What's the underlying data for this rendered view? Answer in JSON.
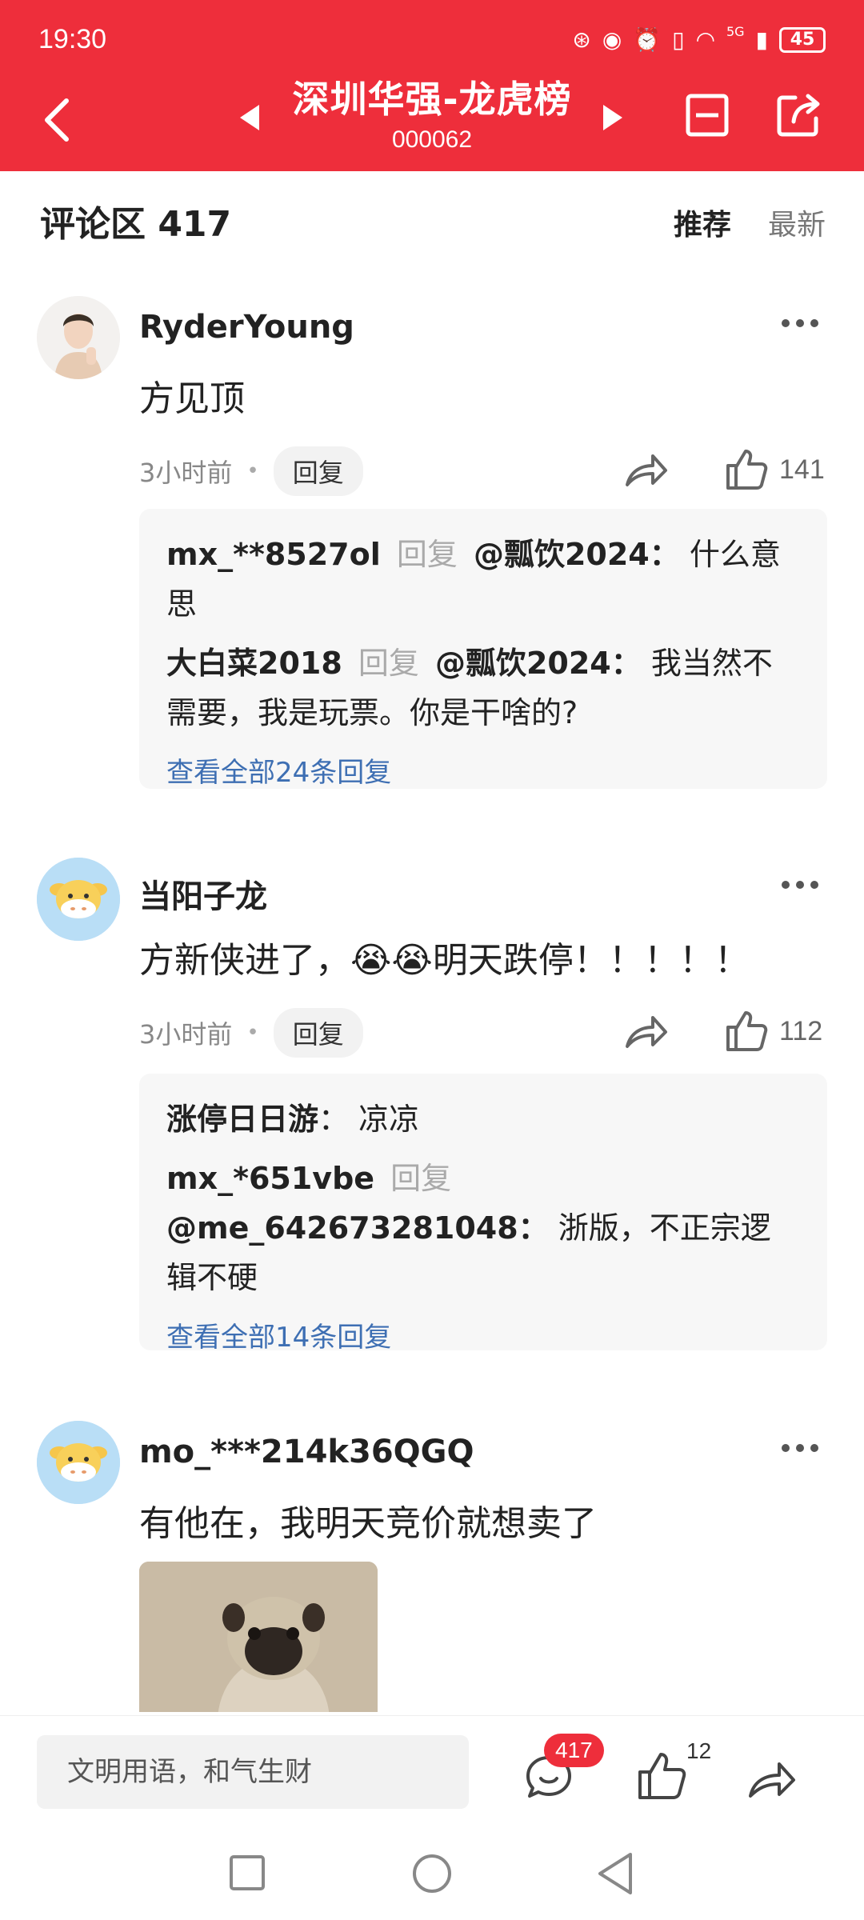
{
  "status_bar": {
    "time": "19:30",
    "network": "5G",
    "battery": "45"
  },
  "header": {
    "title": "深圳华强-龙虎榜",
    "code": "000062"
  },
  "comments_header": {
    "title": "评论区 417",
    "tabs": [
      "推荐",
      "最新"
    ],
    "active_tab": "推荐"
  },
  "comments": [
    {
      "username": "RyderYoung",
      "text": "方见顶",
      "time": "3小时前",
      "reply_label": "回复",
      "likes": "141",
      "replies": [
        {
          "name": "mx_**8527ol",
          "kw": "回复",
          "at": "@瓢饮2024：",
          "text": "什么意思"
        },
        {
          "name": "大白菜2018",
          "kw": "回复",
          "at": "@瓢饮2024：",
          "text": "我当然不需要，我是玩票。你是干啥的?"
        }
      ],
      "view_all": "查看全部24条回复"
    },
    {
      "username": "当阳子龙",
      "text": "方新侠进了，😭😭明天跌停！！！！！",
      "time": "3小时前",
      "reply_label": "回复",
      "likes": "112",
      "replies": [
        {
          "name": "涨停日日游",
          "sep": "：",
          "text": "凉凉"
        },
        {
          "name": "mx_*651vbe",
          "kw": "回复",
          "at": "@me_642673281048：",
          "text": "浙版，不正宗逻辑不硬"
        }
      ],
      "view_all": "查看全部14条回复"
    },
    {
      "username": "mo_***214k36QGQ",
      "text": "有他在，我明天竞价就想卖了"
    }
  ],
  "bottom_bar": {
    "placeholder": "文明用语，和气生财",
    "comment_count": "417",
    "like_count": "12"
  },
  "colors": {
    "brand_red": "#ee2e3b",
    "link_blue": "#3e6fb3"
  }
}
